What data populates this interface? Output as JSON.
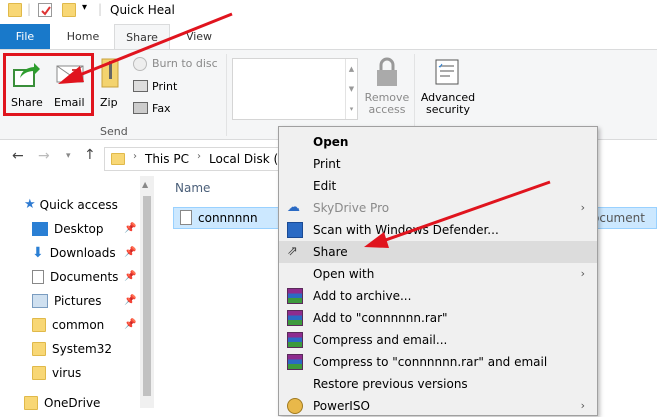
{
  "window": {
    "title": "Quick Heal"
  },
  "tabs": [
    {
      "label": "File"
    },
    {
      "label": "Home"
    },
    {
      "label": "Share"
    },
    {
      "label": "View"
    }
  ],
  "ribbon": {
    "share_label": "Share",
    "email_label": "Email",
    "zip_label": "Zip",
    "burn_label": "Burn to disc",
    "print_label": "Print",
    "fax_label": "Fax",
    "group_label": "Send",
    "remove_access_label": "Remove access",
    "advanced_security_label": "Advanced security"
  },
  "nav": {
    "crumbs": [
      {
        "label": "This PC"
      },
      {
        "label": "Local Disk (E:"
      }
    ]
  },
  "sidebar": {
    "items": [
      {
        "label": "Quick access",
        "icon": "star-icon"
      },
      {
        "label": "Desktop",
        "icon": "desktop-icon"
      },
      {
        "label": "Downloads",
        "icon": "download-icon"
      },
      {
        "label": "Documents",
        "icon": "document-icon"
      },
      {
        "label": "Pictures",
        "icon": "picture-icon"
      },
      {
        "label": "common",
        "icon": "folder-icon"
      },
      {
        "label": "System32",
        "icon": "folder-icon"
      },
      {
        "label": "virus",
        "icon": "folder-icon"
      },
      {
        "label": "OneDrive",
        "icon": "folder-icon"
      }
    ]
  },
  "filelist": {
    "column_name": "Name",
    "file_name": "connnnnn",
    "file_type": "ocument"
  },
  "context_menu": {
    "items": [
      {
        "label": "Open"
      },
      {
        "label": "Print"
      },
      {
        "label": "Edit"
      },
      {
        "label": "SkyDrive Pro"
      },
      {
        "label": "Scan with Windows Defender..."
      },
      {
        "label": "Share"
      },
      {
        "label": "Open with"
      },
      {
        "label": "Add to archive..."
      },
      {
        "label": "Add to \"connnnnn.rar\""
      },
      {
        "label": "Compress and email..."
      },
      {
        "label": "Compress to \"connnnnn.rar\" and email"
      },
      {
        "label": "Restore previous versions"
      },
      {
        "label": "PowerISO"
      }
    ]
  },
  "colors": {
    "accent": "#1979ca",
    "annotation": "#e0141e",
    "selection": "#cce8ff"
  }
}
